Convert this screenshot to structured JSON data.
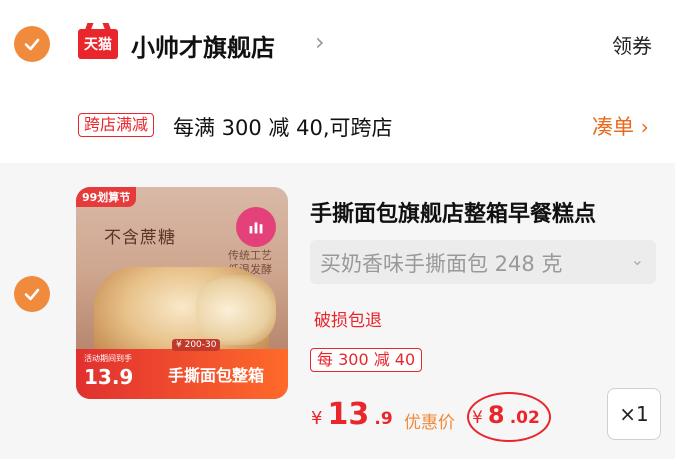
{
  "shop": {
    "badge": "天猫",
    "name": "小帅才旗舰店",
    "coupon_label": "领券"
  },
  "promotion": {
    "tag": "跨店满减",
    "text": "每满 300 减 40,可跨店",
    "action": "凑单"
  },
  "item": {
    "thumb_badge": "99划算节",
    "thumb_title": "不含蔗糖",
    "thumb_side": "传统工艺\n低温发酵",
    "thumb_note": "¥ 200-30",
    "thumb_small": "活动期间到手",
    "thumb_price": "13.9",
    "thumb_name": "手撕面包整箱",
    "title": "手撕面包旗舰店整箱早餐糕点",
    "sku": "买奶香味手撕面包 248 克",
    "service": "破损包退",
    "promo": "每 300 减 40",
    "price_symbol": "¥",
    "price_int": "13",
    "price_dec": ".9",
    "discount_label": "优惠价",
    "discount_symbol": "¥",
    "discount_int": "8",
    "discount_dec": ".02",
    "quantity": "×1"
  },
  "colors": {
    "accent_orange": "#f08a3c",
    "tmall_red": "#e8262c",
    "price_red": "#e8262c"
  },
  "icons": {
    "check": "checkmark-icon",
    "chevron": "chevron-right-icon",
    "dropdown": "chevron-down-icon"
  }
}
